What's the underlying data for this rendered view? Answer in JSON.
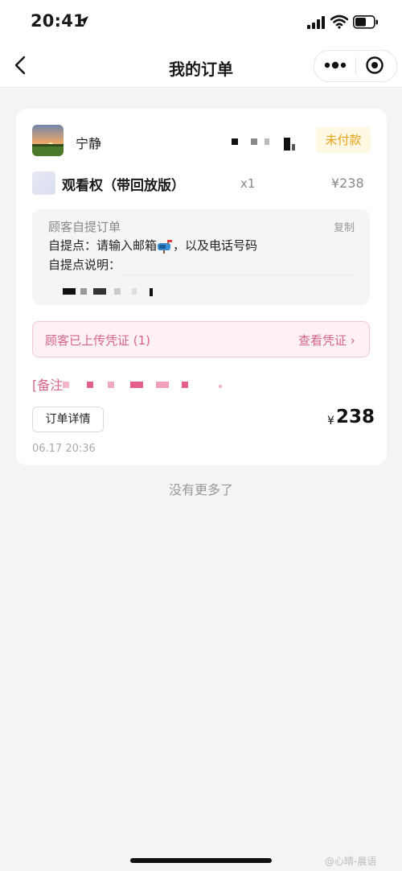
{
  "status_bar": {
    "time": "20:41"
  },
  "nav": {
    "title": "我的订单"
  },
  "order": {
    "buyer_name": "宁静",
    "status_badge": "未付款",
    "product": {
      "name": "观看权（带回放版）",
      "quantity": "x1",
      "price": "¥238"
    },
    "pickup": {
      "title": "顾客自提订单",
      "copy_label": "复制",
      "point_label": "自提点：请输入邮箱",
      "point_label_suffix": "，以及电话号码",
      "description_label": "自提点说明："
    },
    "voucher": {
      "label": "顾客已上传凭证 (1)",
      "link": "查看凭证 ›"
    },
    "remark_prefix": "[备注",
    "detail_button": "订单详情",
    "total": {
      "currency": "¥",
      "value": "238"
    },
    "time": "06.17 20:36"
  },
  "list_end_text": "没有更多了",
  "watermark": "@心晴-晨语",
  "colors": {
    "pending": "#e8a317",
    "accent_pink": "#d8658a",
    "page_bg": "#f4f4f5"
  },
  "icons": [
    "location-arrow-icon",
    "signal-icon",
    "wifi-icon",
    "battery-icon",
    "back-chevron-icon",
    "more-dots-icon",
    "record-circle-icon",
    "mailbox-emoji-icon"
  ]
}
